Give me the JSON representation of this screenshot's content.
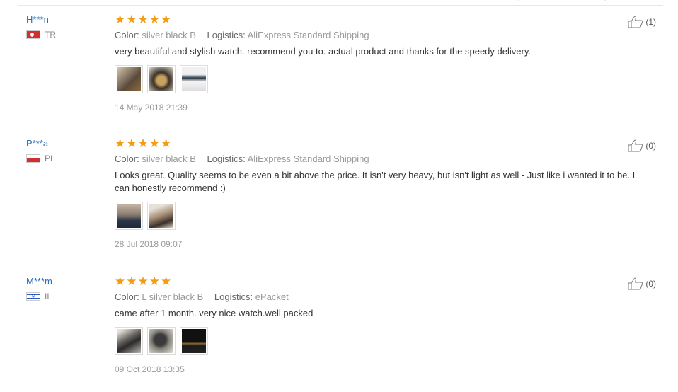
{
  "reviews": [
    {
      "user": "H***n",
      "country": "TR",
      "stars": 5,
      "color_label": "Color:",
      "color_value": "silver black B",
      "logistics_label": "Logistics:",
      "logistics_value": "AliExpress Standard Shipping",
      "text": "very beautiful and stylish watch. recommend you to. actual product and thanks for the speedy delivery.",
      "date": "14 May 2018 21:39",
      "helpful": "(1)"
    },
    {
      "user": "P***a",
      "country": "PL",
      "stars": 5,
      "color_label": "Color:",
      "color_value": "silver black B",
      "logistics_label": "Logistics:",
      "logistics_value": "AliExpress Standard Shipping",
      "text": "Looks great. Quality seems to be even a bit above the price. It isn't very heavy, but isn't light as well - Just like i wanted it to be. I can honestly recommend :)",
      "date": "28 Jul 2018 09:07",
      "helpful": "(0)"
    },
    {
      "user": "M***m",
      "country": "IL",
      "stars": 5,
      "color_label": "Color:",
      "color_value": "L silver black B",
      "logistics_label": "Logistics:",
      "logistics_value": "ePacket",
      "text": "came after 1 month. very nice watch.well packed",
      "date": "09 Oct 2018 13:35",
      "helpful": "(0)"
    }
  ],
  "icons": {
    "star": "star-icon",
    "thumb": "thumbs-up-icon"
  },
  "colors": {
    "accent": "#f39c12",
    "link": "#2a6ebb"
  }
}
